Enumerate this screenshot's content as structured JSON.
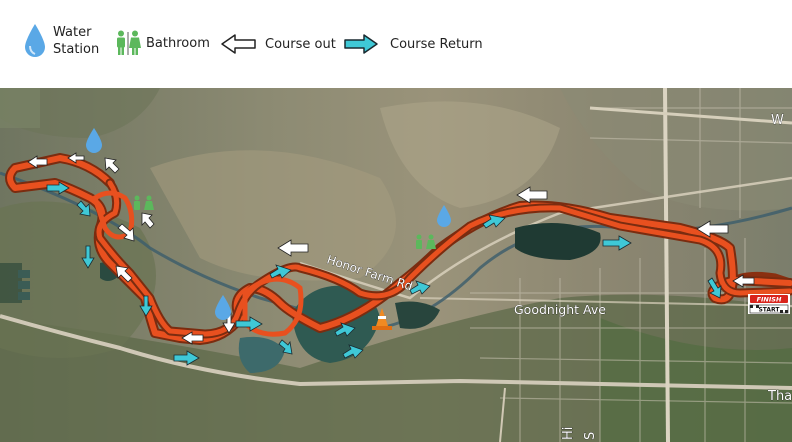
{
  "legend": {
    "water_station": "Water\nStation",
    "bathroom": "Bathroom",
    "course_out": "Course out",
    "course_return": "Course Return"
  },
  "map": {
    "road_labels": {
      "honor_farm_rd": "Honor Farm Rd",
      "goodnight_ave": "Goodnight Ave",
      "w_edge": "W",
      "tha_edge": "Tha",
      "hi_edge": "Hi",
      "s_edge": "S"
    },
    "finish_sign": "FINISH",
    "start_sign": "START"
  },
  "colors": {
    "course": "#e8501f",
    "course_out_arrow": "#ffffff",
    "course_return_arrow": "#3fc8d6",
    "water_drop": "#5aa8e6",
    "bathroom_icon": "#5cb85c"
  }
}
